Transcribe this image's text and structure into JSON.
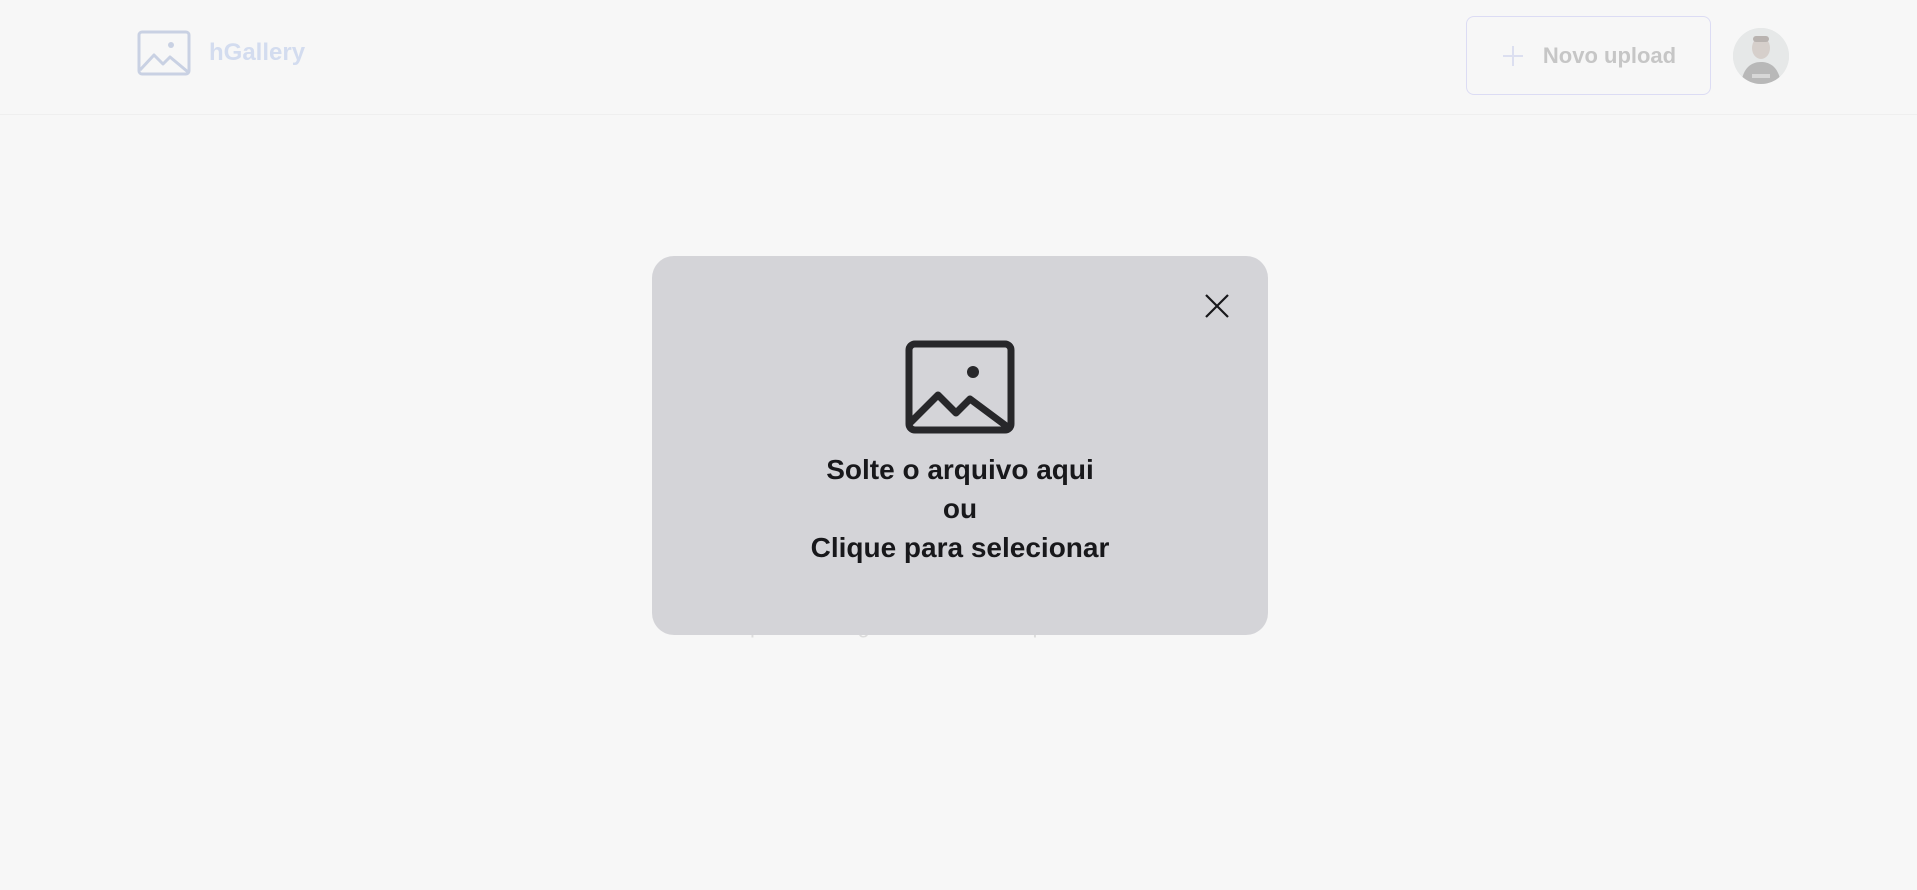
{
  "header": {
    "brand_name": "hGallery",
    "brand_icon": "image-icon",
    "upload_button_label": "Novo upload",
    "upload_button_icon": "plus-icon",
    "avatar_icon": "user-avatar"
  },
  "background": {
    "empty_message_line1": "",
    "empty_message_line2": "upload de alguma foto e volte para visualizar."
  },
  "dropzone": {
    "icon": "image-icon",
    "line1": "Solte o arquivo aqui",
    "line2": "ou",
    "line3": "Clique para selecionar",
    "close_icon": "close-icon"
  },
  "colors": {
    "page_background": "#f7f7f7",
    "dropzone_background": "#d4d4d8",
    "dropzone_text": "#18181b",
    "brand_faded": "#d3dcef",
    "button_border_faded": "#dcdcf4"
  }
}
